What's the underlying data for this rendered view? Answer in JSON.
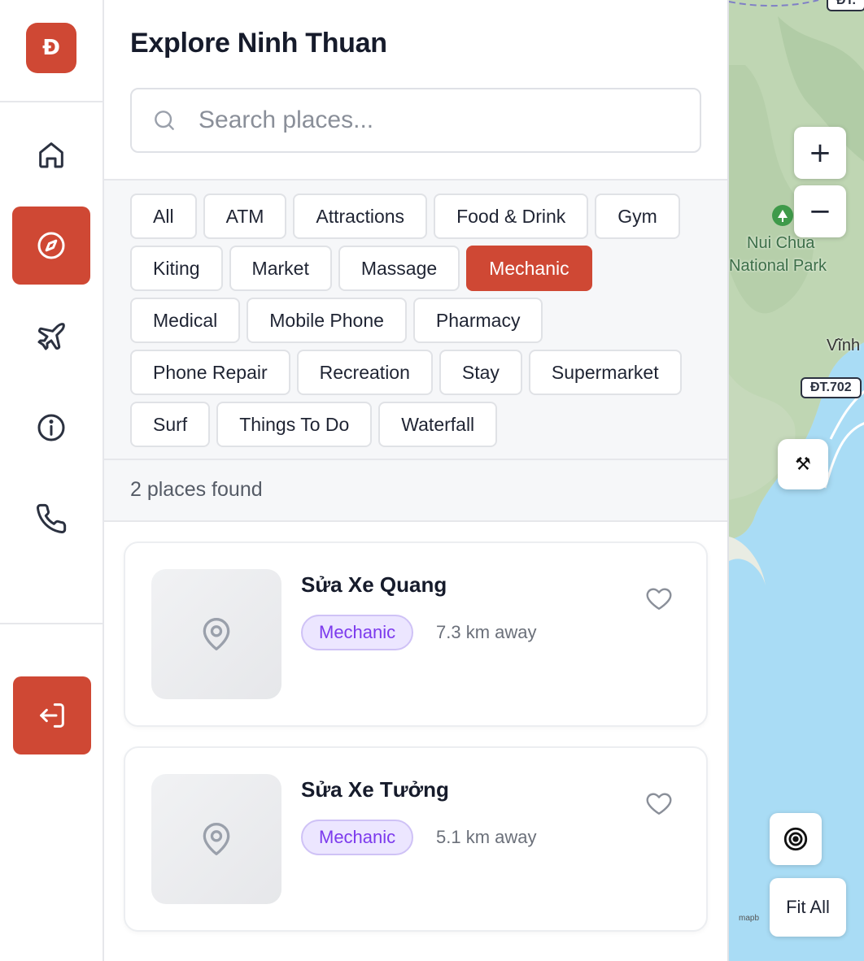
{
  "rail": {
    "logo_letter": "Đ",
    "brand_color": "#cf4834",
    "items": [
      {
        "name": "home",
        "icon": "home-icon"
      },
      {
        "name": "explore",
        "icon": "compass-icon",
        "active": true
      },
      {
        "name": "flights",
        "icon": "plane-icon"
      },
      {
        "name": "info",
        "icon": "info-icon"
      },
      {
        "name": "contact",
        "icon": "phone-icon"
      }
    ],
    "logout_icon": "logout-icon"
  },
  "panel": {
    "title": "Explore Ninh Thuan",
    "search": {
      "placeholder": "Search places...",
      "value": ""
    },
    "filters": [
      "All",
      "ATM",
      "Attractions",
      "Food & Drink",
      "Gym",
      "Kiting",
      "Market",
      "Massage",
      "Mechanic",
      "Medical",
      "Mobile Phone",
      "Pharmacy",
      "Phone Repair",
      "Recreation",
      "Stay",
      "Supermarket",
      "Surf",
      "Things To Do",
      "Waterfall"
    ],
    "active_filter": "Mechanic",
    "results_count": "2 places found",
    "places": [
      {
        "name": "Sửa Xe Quang",
        "category": "Mechanic",
        "distance": "7.3 km away"
      },
      {
        "name": "Sửa Xe Tưởng",
        "category": "Mechanic",
        "distance": "5.1 km away"
      }
    ]
  },
  "map": {
    "zoom_in": "+",
    "zoom_out": "−",
    "park_label_1": "Nui Chua",
    "park_label_2": "National Park",
    "town_label": "Vĩnh",
    "road_top": "ĐT.",
    "road_label": "ĐT.702",
    "marker_icon": "tools-icon",
    "marker_glyph": "⚒",
    "locate_icon": "target-icon",
    "fit_all": "Fit All",
    "attribution": "mapb"
  }
}
